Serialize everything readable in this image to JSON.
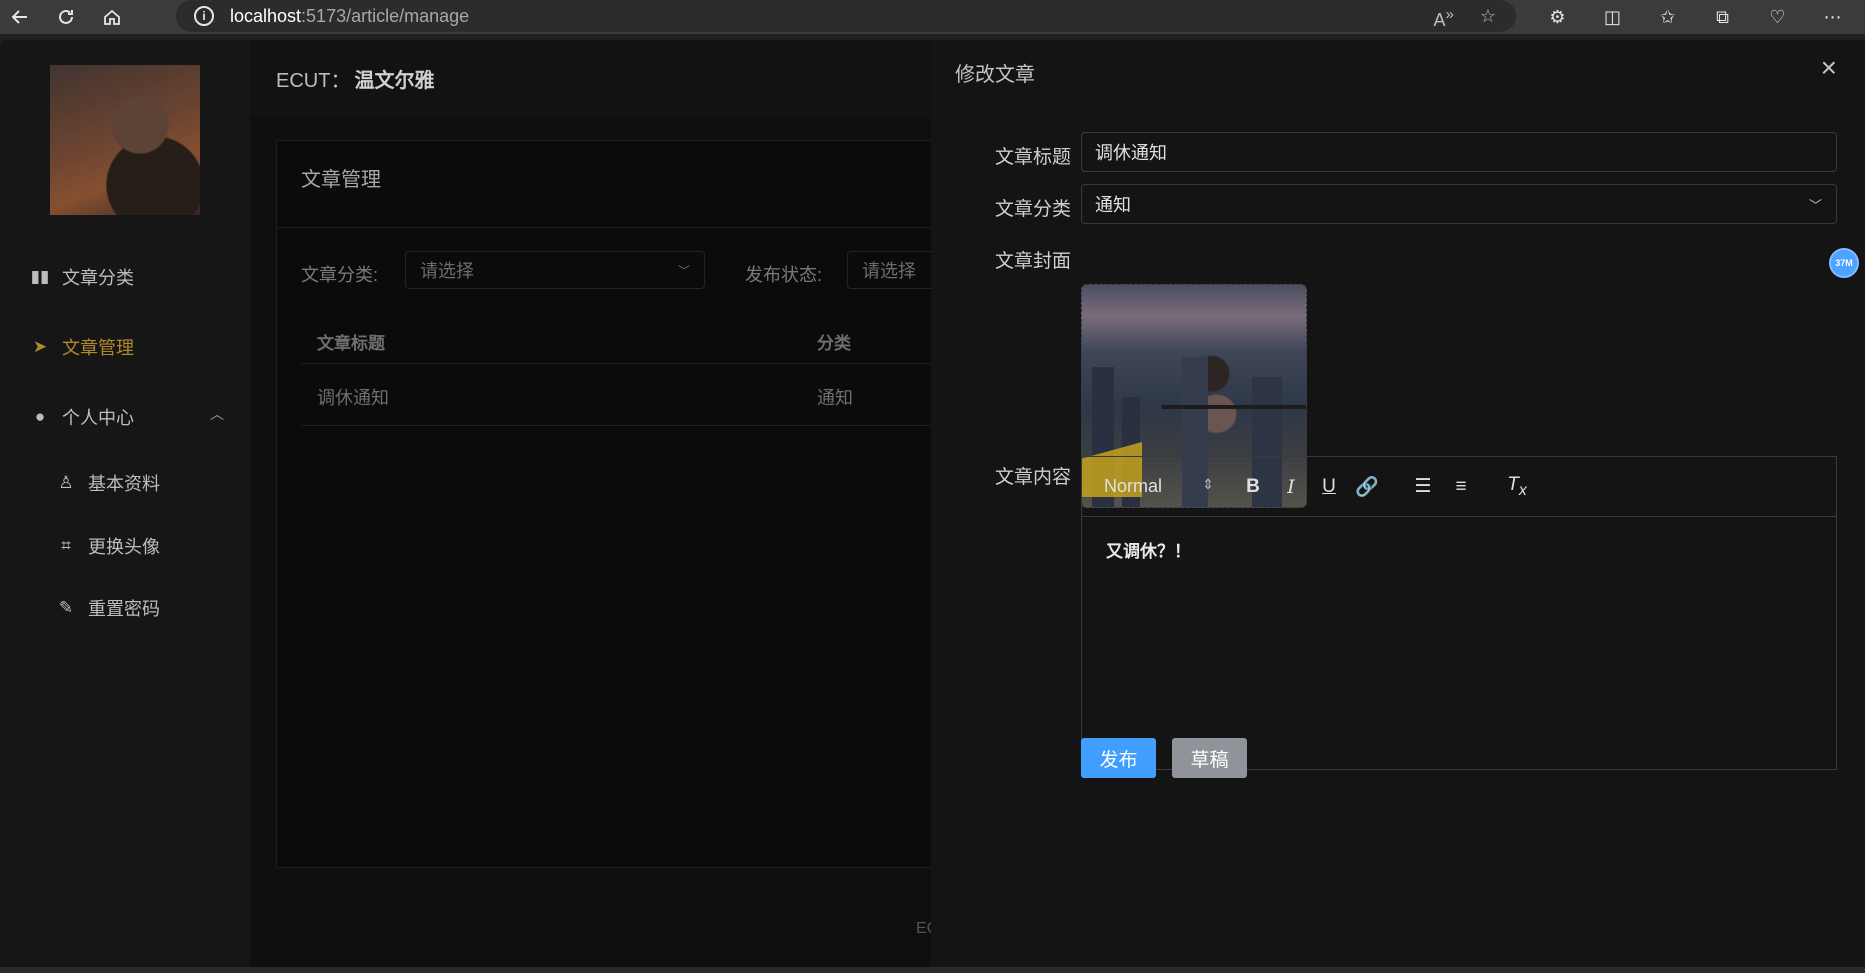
{
  "browser": {
    "url_host": "localhost",
    "url_path": ":5173/article/manage"
  },
  "sidebar": {
    "items": [
      {
        "label": "文章分类",
        "icon": "book-icon"
      },
      {
        "label": "文章管理",
        "icon": "send-icon",
        "active": true
      },
      {
        "label": "个人中心",
        "icon": "user-icon"
      }
    ],
    "sub_items": [
      {
        "label": "基本资料",
        "icon": "user-outline-icon"
      },
      {
        "label": "更换头像",
        "icon": "crop-icon"
      },
      {
        "label": "重置密码",
        "icon": "edit-icon"
      }
    ]
  },
  "header": {
    "prefix": "ECUT：",
    "username": "温文尔雅"
  },
  "card": {
    "title": "文章管理",
    "filters": [
      {
        "label": "文章分类:",
        "placeholder": "请选择"
      },
      {
        "label": "发布状态:",
        "placeholder": "请选择"
      }
    ],
    "table": {
      "columns": [
        "文章标题",
        "分类"
      ],
      "rows": [
        [
          "调休通知",
          "通知"
        ]
      ]
    }
  },
  "footer": "EC",
  "drawer": {
    "title": "修改文章",
    "close": "×",
    "fields": {
      "title_label": "文章标题",
      "title_value": "调休通知",
      "category_label": "文章分类",
      "category_value": "通知",
      "cover_label": "文章封面",
      "content_label": "文章内容"
    },
    "editor": {
      "format": "Normal",
      "content": "又调休？！"
    },
    "buttons": {
      "publish": "发布",
      "draft": "草稿"
    }
  },
  "badge": "37M",
  "colors": {
    "accent": "#409eff",
    "active_menu": "#b08a2a",
    "draft_button": "#909399"
  }
}
